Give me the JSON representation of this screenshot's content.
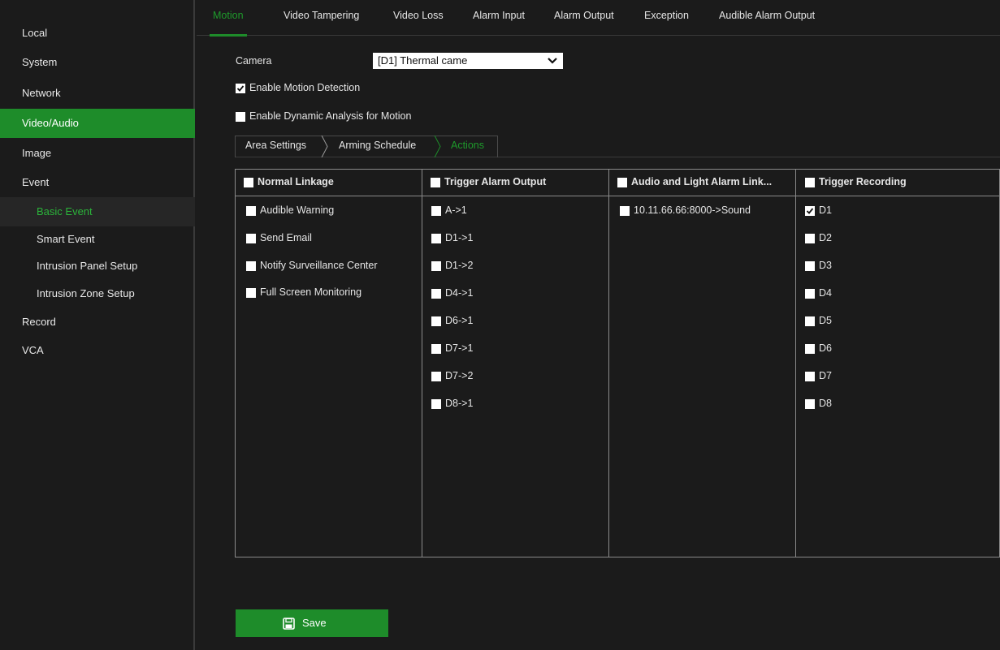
{
  "sidebar": {
    "items": [
      {
        "label": "Local"
      },
      {
        "label": "System"
      },
      {
        "label": "Network"
      },
      {
        "label": "Video/Audio"
      },
      {
        "label": "Image"
      },
      {
        "label": "Event"
      },
      {
        "label": "Basic Event"
      },
      {
        "label": "Smart Event"
      },
      {
        "label": "Intrusion Panel Setup"
      },
      {
        "label": "Intrusion Zone Setup"
      },
      {
        "label": "Record"
      },
      {
        "label": "VCA"
      }
    ]
  },
  "top_tabs": [
    "Motion",
    "Video Tampering",
    "Video Loss",
    "Alarm Input",
    "Alarm Output",
    "Exception",
    "Audible Alarm Output"
  ],
  "form": {
    "camera_label": "Camera",
    "camera_value": "[D1] Thermal came",
    "enable_motion": "Enable Motion Detection",
    "enable_dynamic": "Enable Dynamic Analysis for Motion"
  },
  "sub_tabs": [
    "Area Settings",
    "Arming Schedule",
    "Actions"
  ],
  "table": {
    "columns": [
      {
        "header": "Normal Linkage",
        "items": [
          {
            "label": "Audible Warning",
            "checked": false
          },
          {
            "label": "Send Email",
            "checked": false
          },
          {
            "label": "Notify Surveillance Center",
            "checked": false
          },
          {
            "label": "Full Screen Monitoring",
            "checked": false
          }
        ]
      },
      {
        "header": "Trigger Alarm Output",
        "items": [
          {
            "label": "A->1",
            "checked": false
          },
          {
            "label": "D1->1",
            "checked": false
          },
          {
            "label": "D1->2",
            "checked": false
          },
          {
            "label": "D4->1",
            "checked": false
          },
          {
            "label": "D6->1",
            "checked": false
          },
          {
            "label": "D7->1",
            "checked": false
          },
          {
            "label": "D7->2",
            "checked": false
          },
          {
            "label": "D8->1",
            "checked": false
          }
        ]
      },
      {
        "header": "Audio and Light Alarm Link...",
        "items": [
          {
            "label": "10.11.66.66:8000->Sound",
            "checked": false
          }
        ]
      },
      {
        "header": "Trigger Recording",
        "items": [
          {
            "label": "D1",
            "checked": true
          },
          {
            "label": "D2",
            "checked": false
          },
          {
            "label": "D3",
            "checked": false
          },
          {
            "label": "D4",
            "checked": false
          },
          {
            "label": "D5",
            "checked": false
          },
          {
            "label": "D6",
            "checked": false
          },
          {
            "label": "D7",
            "checked": false
          },
          {
            "label": "D8",
            "checked": false
          }
        ]
      }
    ]
  },
  "save_label": "Save",
  "colors": {
    "accent": "#1e8c2a",
    "background": "#1b1b1b"
  }
}
